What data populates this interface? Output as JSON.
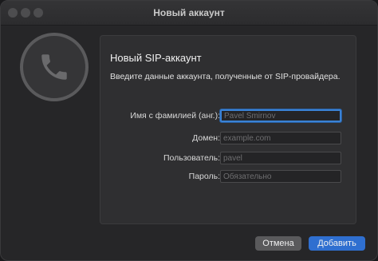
{
  "window": {
    "title": "Новый аккаунт"
  },
  "icon": {
    "name": "phone-icon"
  },
  "panel": {
    "title": "Новый SIP-аккаунт",
    "description": "Введите данные аккаунта, полученные от SIP-провайдера."
  },
  "form": {
    "name": {
      "label": "Имя с фамилией (анг.):",
      "value": "",
      "placeholder": "Pavel Smirnov"
    },
    "domain": {
      "label": "Домен:",
      "value": "",
      "placeholder": "example.com"
    },
    "user": {
      "label": "Пользователь:",
      "value": "",
      "placeholder": "pavel"
    },
    "password": {
      "label": "Пароль:",
      "value": "",
      "placeholder": "Обязательно"
    }
  },
  "buttons": {
    "cancel": "Отмена",
    "add": "Добавить"
  },
  "colors": {
    "accent": "#2f6fd0",
    "focus_ring": "#3a82d6",
    "window_bg": "#262628"
  }
}
